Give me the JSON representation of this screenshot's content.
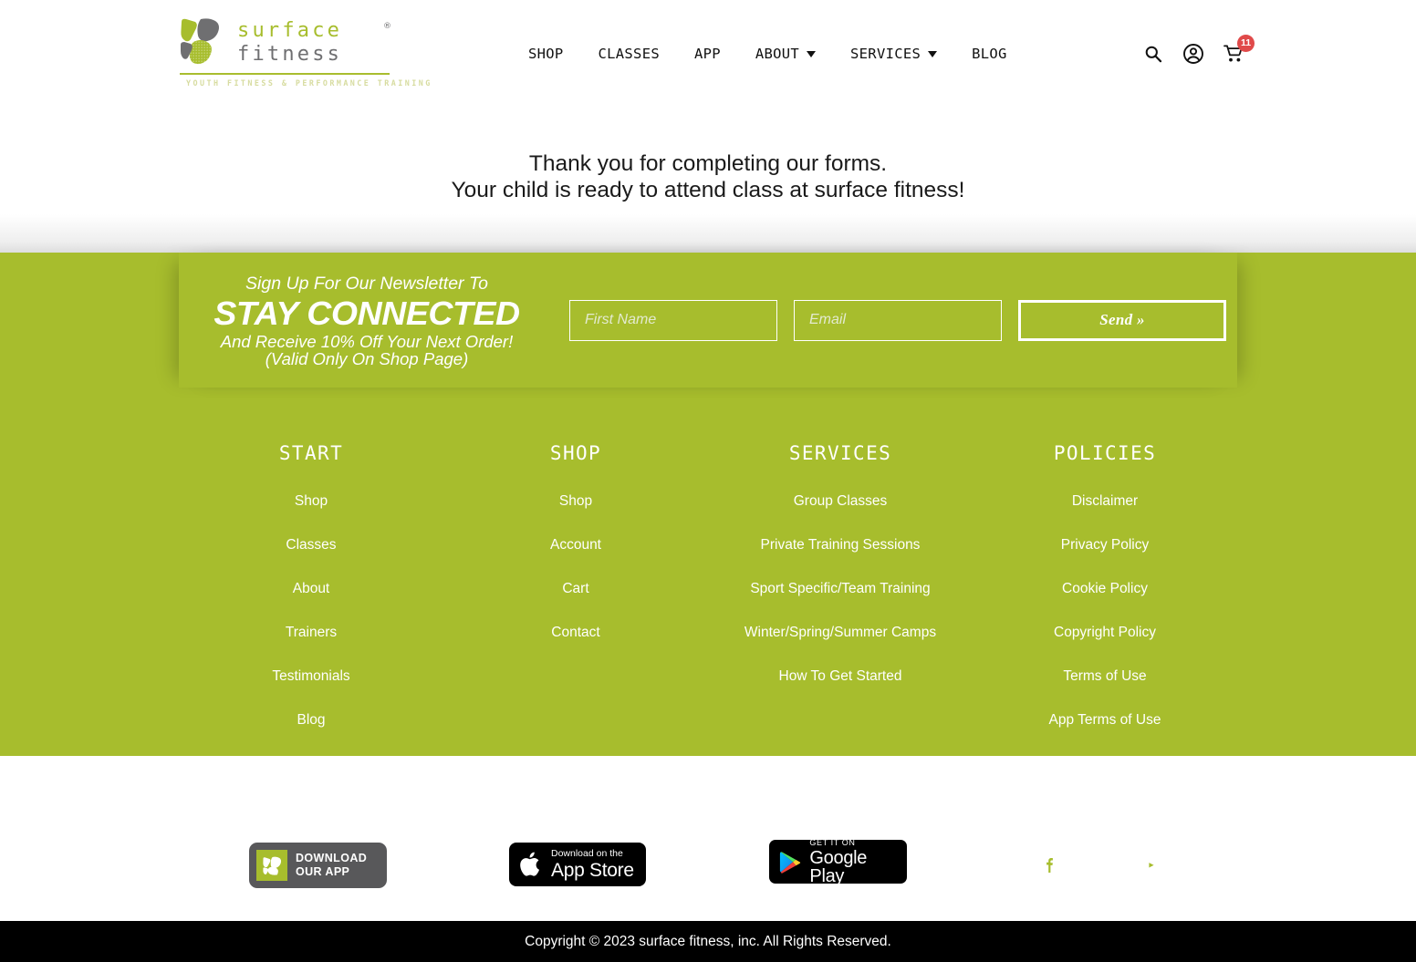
{
  "header": {
    "logo": {
      "word_top": "surface",
      "word_bottom": "fitness",
      "registered": "®",
      "tagline": "YOUTH FITNESS & PERFORMANCE TRAINING"
    },
    "nav": [
      {
        "label": "SHOP",
        "has_dropdown": false
      },
      {
        "label": "CLASSES",
        "has_dropdown": false
      },
      {
        "label": "APP",
        "has_dropdown": false
      },
      {
        "label": "ABOUT",
        "has_dropdown": true
      },
      {
        "label": "SERVICES",
        "has_dropdown": true
      },
      {
        "label": "BLOG",
        "has_dropdown": false
      }
    ],
    "icons": {
      "search": "search-icon",
      "account": "user-account-icon",
      "cart": "shopping-cart-icon"
    },
    "cart_count": "11",
    "cart_badge_color": "#e04a4a"
  },
  "hero": {
    "line1": "Thank you for completing our forms.",
    "line2": "Your child is ready to attend class at surface fitness!"
  },
  "newsletter": {
    "top_line": "Sign Up For Our Newsletter To",
    "headline": "STAY CONNECTED",
    "sub_line1": "And Receive 10% Off Your Next Order!",
    "sub_line2": "(Valid Only On Shop Page)",
    "first_name_placeholder": "First Name",
    "first_name_value": "",
    "email_placeholder": "Email",
    "email_value": "",
    "send_label": "Send »"
  },
  "footer": {
    "columns": [
      {
        "title": "START",
        "links": [
          "Shop",
          "Classes",
          "About",
          "Trainers",
          "Testimonials",
          "Blog"
        ]
      },
      {
        "title": "SHOP",
        "links": [
          "Shop",
          "Account",
          "Cart",
          "Contact"
        ]
      },
      {
        "title": "SERVICES",
        "links": [
          "Group Classes",
          "Private Training Sessions",
          "Sport Specific/Team Training",
          "Winter/Spring/Summer Camps",
          "How To Get Started"
        ]
      },
      {
        "title": "POLICIES",
        "links": [
          "Disclaimer",
          "Privacy Policy",
          "Cookie Policy",
          "Copyright Policy",
          "Terms of Use",
          "App Terms of Use"
        ]
      }
    ],
    "badges": {
      "download_app_line1": "DOWNLOAD",
      "download_app_line2": "OUR APP",
      "appstore_small": "Download on the",
      "appstore_big": "App Store",
      "gplay_small": "GET IT ON",
      "gplay_big": "Google Play"
    },
    "socials": [
      {
        "name": "facebook-icon"
      },
      {
        "name": "instagram-icon"
      },
      {
        "name": "youtube-icon"
      }
    ],
    "copyright": "Copyright © 2023 surface fitness, inc. All Rights Reserved."
  },
  "colors": {
    "brand_green": "#a7bd2d",
    "dark_gray": "#58585a",
    "badge_red": "#e04a4a",
    "black": "#000000"
  }
}
